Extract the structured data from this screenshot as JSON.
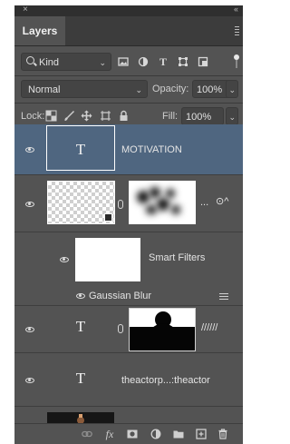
{
  "panel": {
    "close_glyph": "×",
    "collapse_glyph": "‹‹",
    "tab_label": "Layers"
  },
  "filter": {
    "kind_label": "Kind",
    "kind_chevron": "⌄",
    "icons": [
      "image-filter-icon",
      "adjustment-filter-icon",
      "type-filter-icon",
      "shape-filter-icon",
      "smart-object-filter-icon"
    ],
    "type_glyph": "T"
  },
  "blend": {
    "mode": "Normal",
    "opacity_label": "Opacity:",
    "opacity_value": "100%",
    "chevron": "⌄"
  },
  "lock": {
    "label": "Lock:",
    "fill_label": "Fill:",
    "fill_value": "100%",
    "icons": [
      "lock-transparent-pixels-icon",
      "lock-image-pixels-icon",
      "lock-position-icon",
      "lock-artboard-icon",
      "lock-all-icon"
    ]
  },
  "layers": [
    {
      "name": "MOTIVATION",
      "kind": "text",
      "selected": true,
      "visible": true,
      "thumb_glyph": "T"
    },
    {
      "name": "...",
      "kind": "smart-object",
      "selected": false,
      "visible": true,
      "extra_glyph": "⊙^"
    },
    {
      "name": "Smart Filters",
      "kind": "smart-filters",
      "visible": true
    },
    {
      "name": "Gaussian Blur",
      "kind": "filter-effect",
      "visible": true
    },
    {
      "name": "//////",
      "kind": "text-with-mask",
      "visible": true,
      "thumb_glyph": "T"
    },
    {
      "name": "theactorp...:theactor",
      "kind": "text",
      "visible": true,
      "thumb_glyph": "T"
    }
  ],
  "footer": {
    "fx_label": "fx",
    "icons": [
      "link-layers-icon",
      "layer-style-icon",
      "add-mask-icon",
      "adjustment-layer-icon",
      "new-group-icon",
      "new-layer-icon",
      "delete-layer-icon"
    ]
  },
  "colors": {
    "panel_bg": "#535353",
    "selected_layer": "#4f6680",
    "tab_bar": "#3c3c3c"
  }
}
